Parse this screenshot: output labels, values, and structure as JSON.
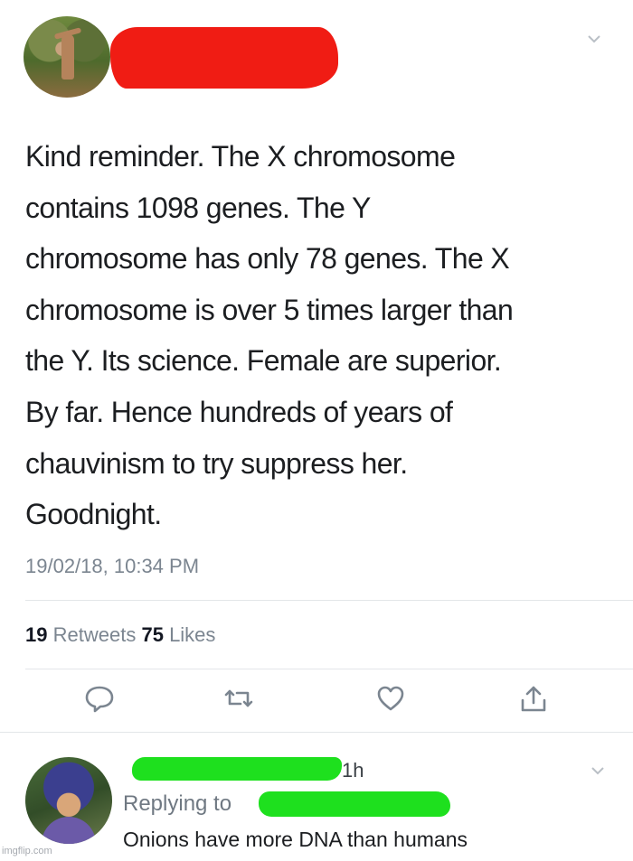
{
  "tweet": {
    "text": "Kind reminder. The X chromosome\ncontains 1098 genes. The Y\nchromosome has only 78 genes. The X\nchromosome is over 5 times larger than\nthe Y. Its science. Female are superior.\nBy far. Hence hundreds of years of\nchauvinism to try suppress her.\nGoodnight.",
    "timestamp": "19/02/18, 10:34 PM",
    "retweet_count": "19",
    "retweet_label": "Retweets",
    "like_count": "75",
    "like_label": "Likes",
    "actions": [
      "reply-icon",
      "retweet-icon",
      "heart-icon",
      "share-icon"
    ]
  },
  "reply": {
    "time": "1h",
    "replying_to_label": "Replying to",
    "text": "Onions have more DNA than humans"
  },
  "watermark": "imgflip.com",
  "colors": {
    "redaction_red": "#f01c14",
    "redaction_green": "#1ee01e",
    "meta_gray": "#7b8590"
  }
}
